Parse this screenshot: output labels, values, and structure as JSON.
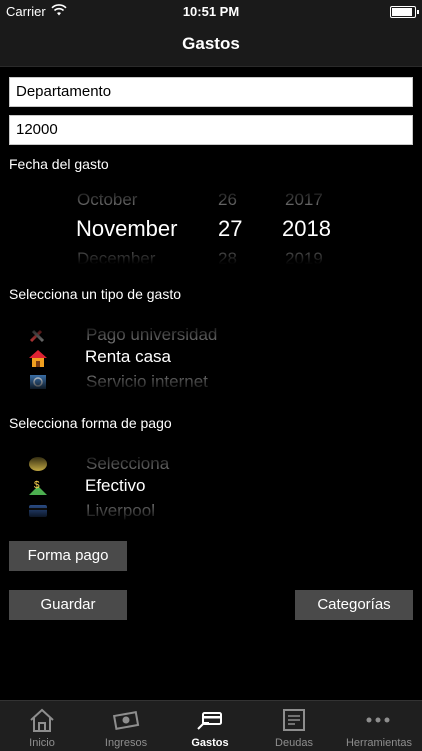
{
  "status": {
    "carrier": "Carrier",
    "time": "10:51 PM"
  },
  "nav": {
    "title": "Gastos"
  },
  "form": {
    "description_value": "Departamento",
    "amount_value": "12000",
    "date_label": "Fecha del gasto"
  },
  "date_picker": {
    "months": [
      "October",
      "November",
      "December"
    ],
    "days": [
      "26",
      "27",
      "28"
    ],
    "years": [
      "2017",
      "2018",
      "2019"
    ]
  },
  "expense_type": {
    "label": "Selecciona un tipo de gasto",
    "options": [
      "Pago universidad",
      "Renta casa",
      "Servicio internet"
    ]
  },
  "payment_method": {
    "label": "Selecciona forma de pago",
    "options": [
      "Selecciona",
      "Efectivo",
      "Liverpool"
    ]
  },
  "buttons": {
    "payment": "Forma pago",
    "save": "Guardar",
    "categories": "Categorías"
  },
  "tabs": [
    {
      "label": "Inicio",
      "icon": "home-icon"
    },
    {
      "label": "Ingresos",
      "icon": "money-icon"
    },
    {
      "label": "Gastos",
      "icon": "card-payment-icon",
      "active": true
    },
    {
      "label": "Deudas",
      "icon": "invoice-icon"
    },
    {
      "label": "Herramientas",
      "icon": "more-icon"
    }
  ],
  "colors": {
    "background": "#000000",
    "button": "#4a4a4a",
    "faded_text": "#6e6e6e"
  }
}
